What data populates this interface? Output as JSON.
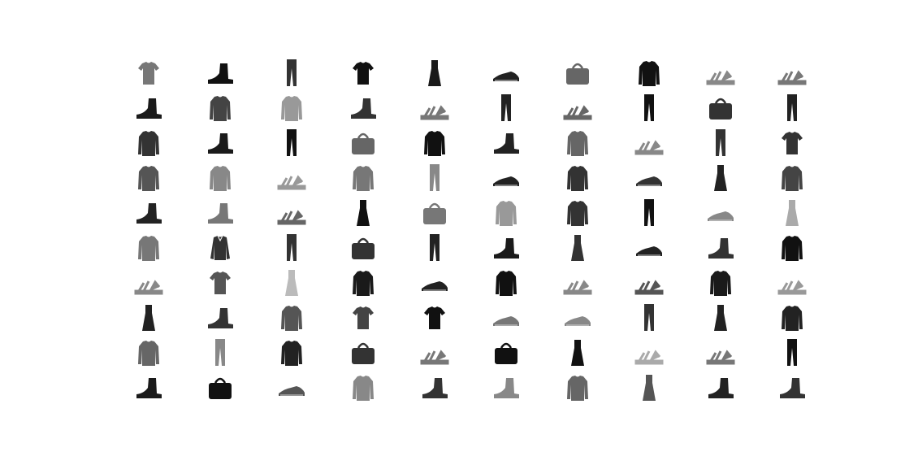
{
  "figure": {
    "rows": 10,
    "cols": 10,
    "tiles": [
      [
        "tshirt",
        "ankle-boot",
        "trouser",
        "tshirt",
        "dress",
        "sneaker",
        "bag",
        "pullover",
        "sandal",
        "sandal"
      ],
      [
        "ankle-boot",
        "pullover",
        "pullover",
        "ankle-boot",
        "sandal",
        "trouser",
        "sandal",
        "trouser",
        "bag",
        "trouser"
      ],
      [
        "pullover",
        "ankle-boot",
        "trouser",
        "bag",
        "pullover",
        "ankle-boot",
        "pullover",
        "sandal",
        "trouser",
        "tshirt"
      ],
      [
        "pullover",
        "pullover",
        "sandal",
        "pullover",
        "trouser",
        "sneaker",
        "pullover",
        "sneaker",
        "dress",
        "pullover"
      ],
      [
        "ankle-boot",
        "ankle-boot",
        "sandal",
        "dress",
        "bag",
        "pullover",
        "pullover",
        "trouser",
        "sneaker",
        "dress"
      ],
      [
        "pullover",
        "shirt",
        "trouser",
        "bag",
        "trouser",
        "ankle-boot",
        "dress",
        "sneaker",
        "ankle-boot",
        "pullover"
      ],
      [
        "sandal",
        "tshirt",
        "dress",
        "pullover",
        "sneaker",
        "pullover",
        "sandal",
        "sandal",
        "pullover",
        "sandal"
      ],
      [
        "dress",
        "ankle-boot",
        "pullover",
        "tshirt",
        "tshirt",
        "sneaker",
        "sneaker",
        "trouser",
        "dress",
        "pullover"
      ],
      [
        "pullover",
        "trouser",
        "pullover",
        "bag",
        "sandal",
        "bag",
        "dress",
        "sandal",
        "sandal",
        "trouser"
      ],
      [
        "ankle-boot",
        "bag",
        "sneaker",
        "pullover",
        "ankle-boot",
        "ankle-boot",
        "pullover",
        "dress",
        "ankle-boot",
        "ankle-boot"
      ]
    ],
    "tones": [
      [
        "#777",
        "#111",
        "#333",
        "#111",
        "#1a1a1a",
        "#222",
        "#666",
        "#111",
        "#888",
        "#777"
      ],
      [
        "#1a1a1a",
        "#444",
        "#999",
        "#333",
        "#777",
        "#222",
        "#666",
        "#111",
        "#333",
        "#222"
      ],
      [
        "#333",
        "#1a1a1a",
        "#111",
        "#666",
        "#111",
        "#222",
        "#666",
        "#888",
        "#333",
        "#333"
      ],
      [
        "#555",
        "#888",
        "#999",
        "#777",
        "#888",
        "#222",
        "#333",
        "#333",
        "#222",
        "#444"
      ],
      [
        "#222",
        "#777",
        "#666",
        "#111",
        "#777",
        "#999",
        "#333",
        "#111",
        "#888",
        "#aaa"
      ],
      [
        "#777",
        "#333",
        "#333",
        "#333",
        "#222",
        "#1a1a1a",
        "#333",
        "#222",
        "#333",
        "#111"
      ],
      [
        "#888",
        "#555",
        "#bbb",
        "#1a1a1a",
        "#222",
        "#111",
        "#888",
        "#555",
        "#1a1a1a",
        "#999"
      ],
      [
        "#222",
        "#333",
        "#555",
        "#444",
        "#111",
        "#777",
        "#888",
        "#333",
        "#222",
        "#222"
      ],
      [
        "#666",
        "#888",
        "#222",
        "#333",
        "#777",
        "#111",
        "#111",
        "#aaa",
        "#777",
        "#111"
      ],
      [
        "#1a1a1a",
        "#111",
        "#555",
        "#888",
        "#333",
        "#888",
        "#666",
        "#555",
        "#222",
        "#333"
      ]
    ]
  }
}
